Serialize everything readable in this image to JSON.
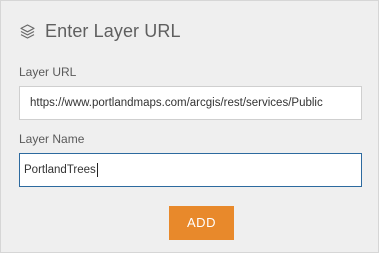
{
  "header": {
    "title": "Enter Layer URL",
    "icon": "layers-icon"
  },
  "form": {
    "url_label": "Layer URL",
    "url_value": "https://www.portlandmaps.com/arcgis/rest/services/Public",
    "name_label": "Layer Name",
    "name_value": "PortlandTrees",
    "add_label": "ADD"
  },
  "colors": {
    "accent": "#e8892b",
    "panel_background": "#efefef",
    "focus_border": "#2d6a9f"
  }
}
